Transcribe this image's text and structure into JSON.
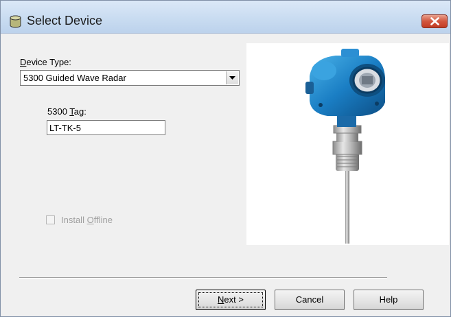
{
  "window": {
    "title": "Select Device"
  },
  "form": {
    "device_type_label_mnemonic": "D",
    "device_type_label_rest": "evice Type:",
    "device_type_value": "5300 Guided Wave Radar",
    "tag_label_prefix": "5300 ",
    "tag_label_mnemonic": "T",
    "tag_label_rest": "ag:",
    "tag_value": "LT-TK-5",
    "offline_label_prefix": "Install ",
    "offline_label_mnemonic": "O",
    "offline_label_rest": "ffline",
    "offline_checked": false,
    "offline_enabled": false
  },
  "image": {
    "icon": "radar-level-transmitter-image"
  },
  "buttons": {
    "next_mnemonic": "N",
    "next_rest": "ext >",
    "cancel": "Cancel",
    "help": "Help"
  },
  "colors": {
    "titlebar": "#c9dcf1",
    "close_button": "#d2553d",
    "dialog_background": "#f0f0f0",
    "device_body": "#1a7ec4"
  }
}
